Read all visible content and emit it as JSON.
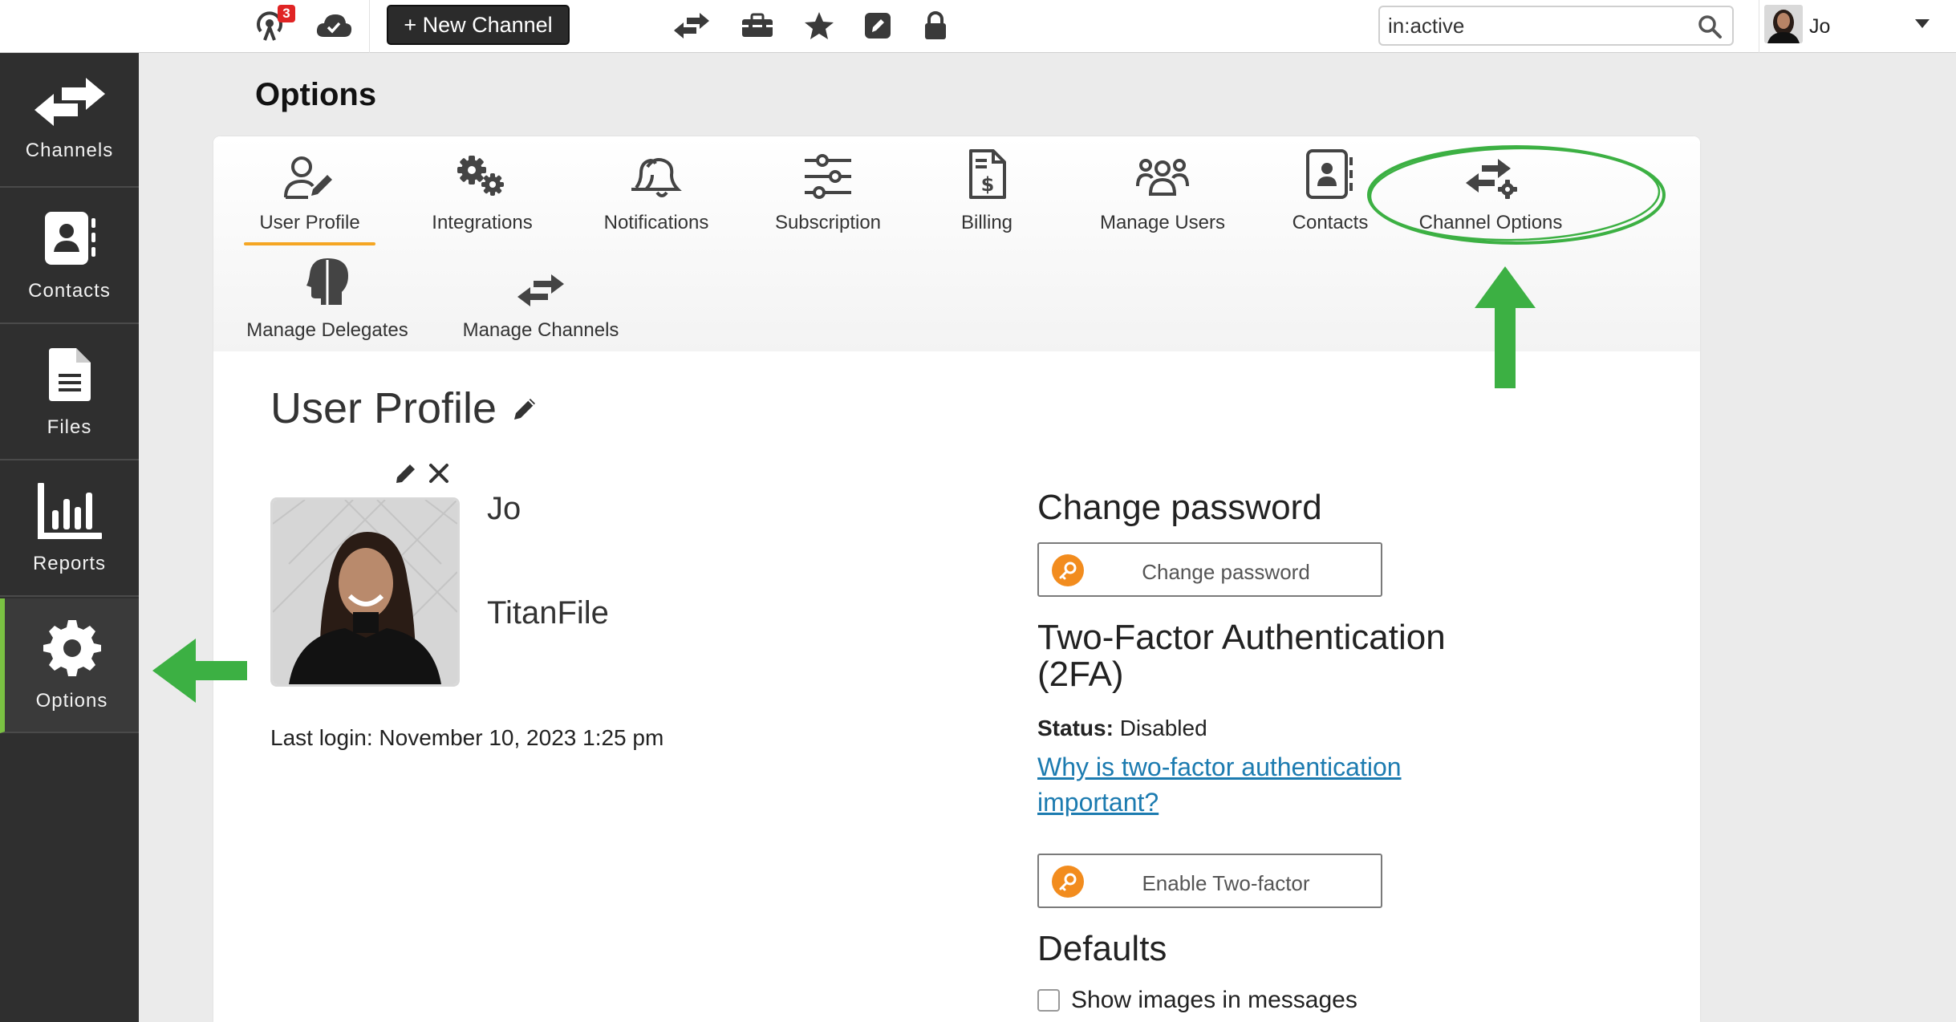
{
  "topbar": {
    "notification_count": "3",
    "new_channel_label": "+ New Channel",
    "search_value": "in:active",
    "user_name": "Jo",
    "icons": [
      "broadcast-icon",
      "cloud-check-icon",
      "swap-arrows-icon",
      "toolbox-icon",
      "star-icon",
      "pencil-square-icon",
      "lock-icon",
      "search-icon",
      "chevron-down-icon"
    ]
  },
  "sidebar": {
    "items": [
      {
        "label": "Channels",
        "icon": "swap-arrows-icon"
      },
      {
        "label": "Contacts",
        "icon": "contact-book-icon"
      },
      {
        "label": "Files",
        "icon": "file-icon"
      },
      {
        "label": "Reports",
        "icon": "bar-chart-icon"
      },
      {
        "label": "Options",
        "icon": "gear-icon",
        "active": true
      }
    ],
    "active_color": "#7ac142"
  },
  "page": {
    "title": "Options"
  },
  "tabs": [
    {
      "label": "User Profile",
      "icon": "user-edit-icon",
      "active": true
    },
    {
      "label": "Integrations",
      "icon": "gears-icon"
    },
    {
      "label": "Notifications",
      "icon": "bells-icon"
    },
    {
      "label": "Subscription",
      "icon": "sliders-icon"
    },
    {
      "label": "Billing",
      "icon": "invoice-dollar-icon"
    },
    {
      "label": "Manage Users",
      "icon": "users-icon"
    },
    {
      "label": "Contacts",
      "icon": "contact-book-icon"
    },
    {
      "label": "Channel Options",
      "icon": "swap-arrows-gear-icon"
    },
    {
      "label": "Manage Delegates",
      "icon": "head-profile-icon"
    },
    {
      "label": "Manage Channels",
      "icon": "swap-arrows-icon"
    }
  ],
  "profile": {
    "section_title": "User Profile",
    "name": "Jo",
    "company": "TitanFile",
    "last_login": "Last login: November 10, 2023 1:25 pm"
  },
  "security": {
    "change_password_heading": "Change password",
    "change_password_button": "Change password",
    "twofa_heading_line1": "Two-Factor Authentication",
    "twofa_heading_line2": "(2FA)",
    "status_label": "Status:",
    "status_value": "Disabled",
    "twofa_link": "Why is two-factor authentication important?",
    "enable_twofa_button": "Enable Two-factor"
  },
  "defaults": {
    "heading": "Defaults",
    "show_images_label": "Show images in messages",
    "show_images_checked": false
  },
  "colors": {
    "accent_underline": "#f5a623",
    "key_badge": "#f28c1e",
    "link": "#1c7bb0",
    "annotation_green": "#3cb043",
    "sidebar_bg": "#2f2f2f"
  }
}
